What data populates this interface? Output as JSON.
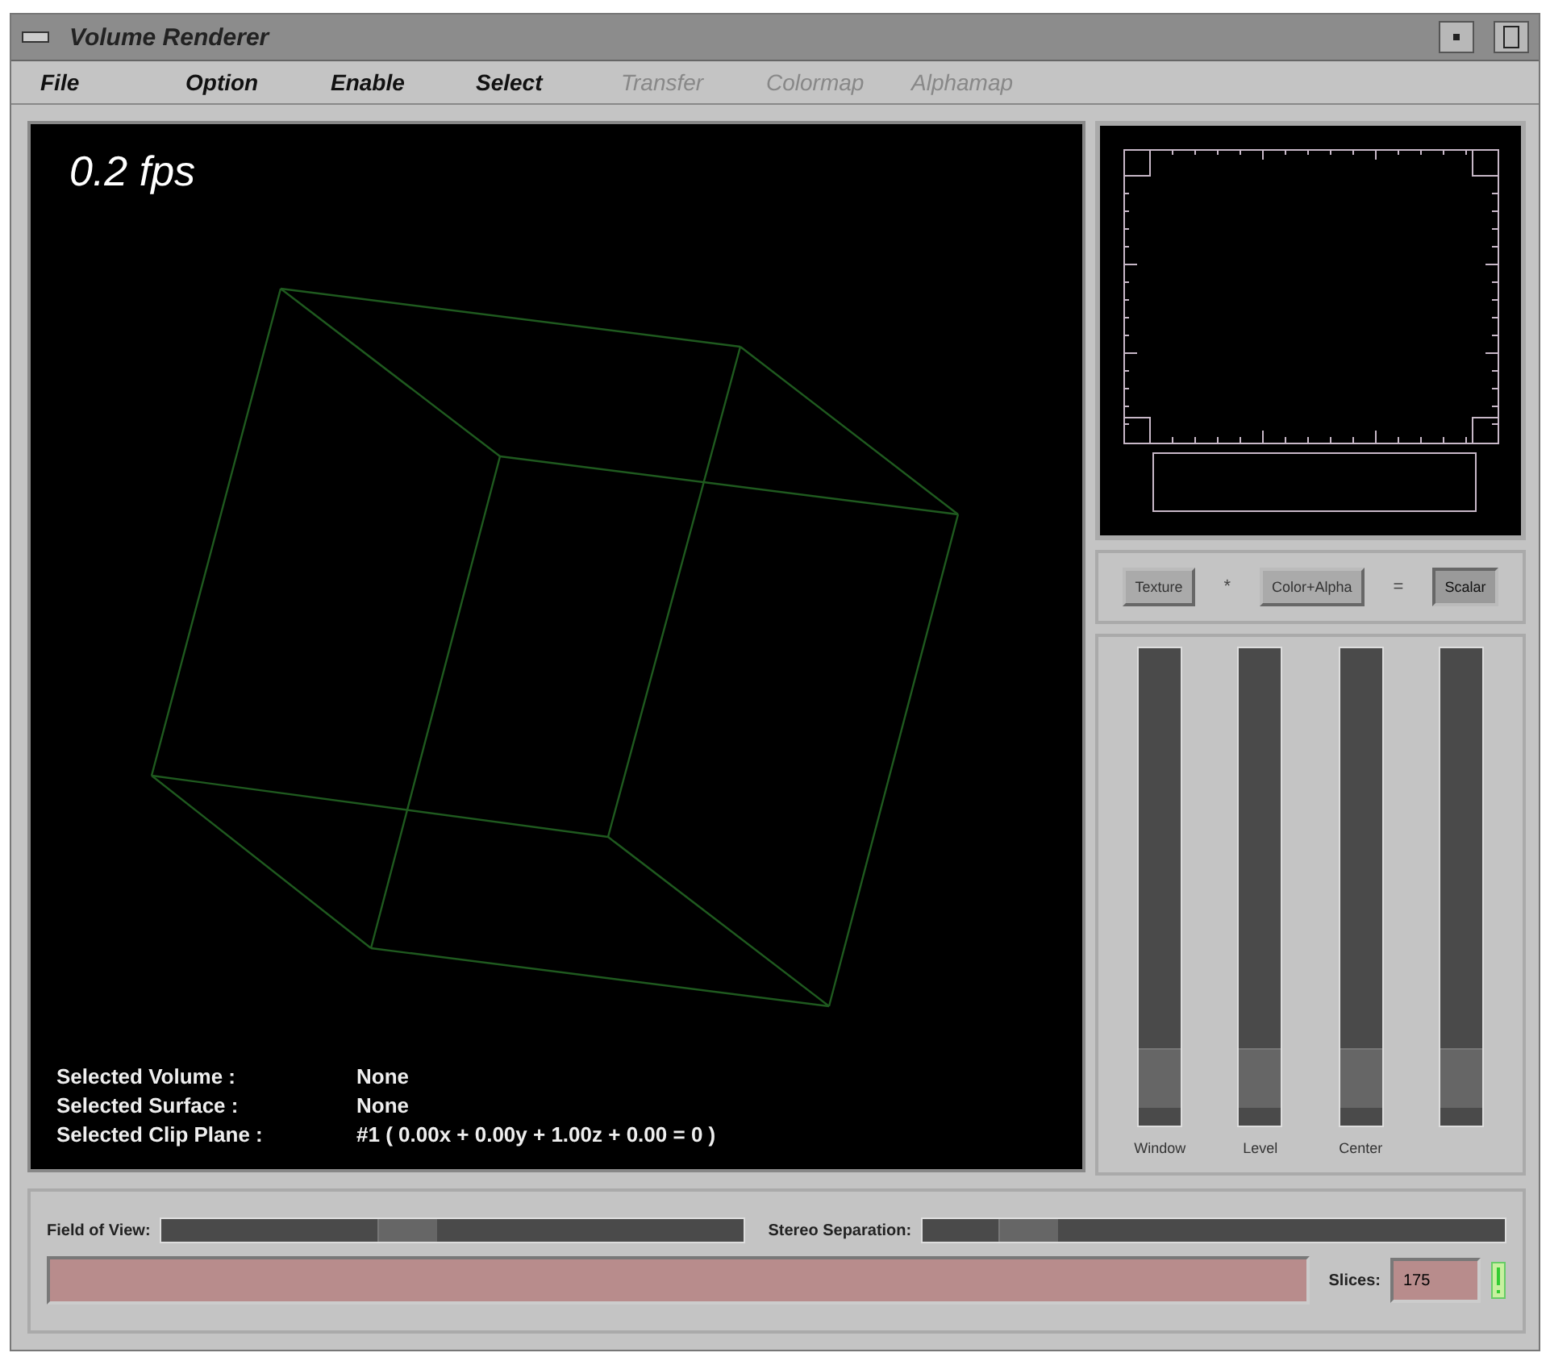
{
  "window": {
    "title": "Volume Renderer"
  },
  "menu": [
    {
      "label": "File",
      "disabled": false
    },
    {
      "label": "Option",
      "disabled": false
    },
    {
      "label": "Enable",
      "disabled": false
    },
    {
      "label": "Select",
      "disabled": false
    },
    {
      "label": "Transfer",
      "disabled": true
    },
    {
      "label": "Colormap",
      "disabled": true
    },
    {
      "label": "Alphamap",
      "disabled": true
    }
  ],
  "viewport": {
    "fps": "0.2 fps",
    "info": [
      {
        "label": "Selected Volume :",
        "value": "None"
      },
      {
        "label": "Selected Surface :",
        "value": "None"
      },
      {
        "label": "Selected Clip Plane :",
        "value": "#1  ( 0.00x + 0.00y + 1.00z + 0.00 = 0 )"
      }
    ]
  },
  "mode_buttons": [
    {
      "label": "Texture",
      "selected": false,
      "op": "*"
    },
    {
      "label": "Color+Alpha",
      "selected": false,
      "op": "="
    },
    {
      "label": "Scalar",
      "selected": true
    }
  ],
  "vertical_sliders": [
    {
      "label": "Window",
      "level": 0.04
    },
    {
      "label": "Level",
      "level": 0.04
    },
    {
      "label": "Center",
      "level": 0.04
    },
    {
      "level": 0.04
    }
  ],
  "field_of_view": {
    "label": "Field of View:",
    "level": 0.37
  },
  "stereo_separation": {
    "label": "Stereo Separation:",
    "level": 0.13
  },
  "slices": {
    "label": "Slices:",
    "value": "175"
  }
}
